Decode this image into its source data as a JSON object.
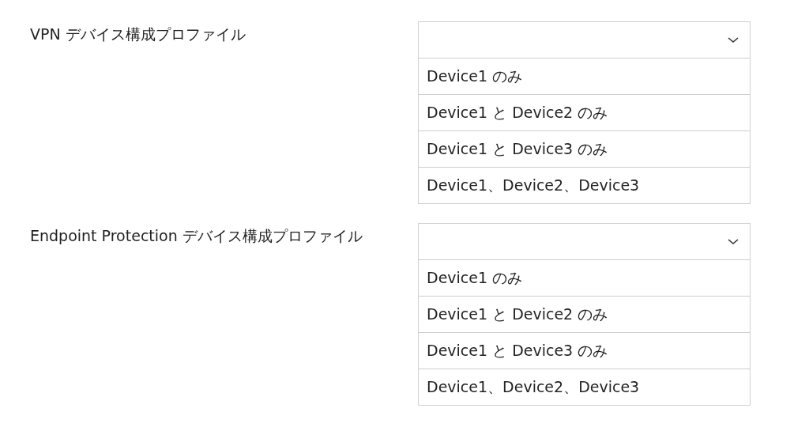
{
  "questions": [
    {
      "label": "VPN デバイス構成プロファイル",
      "options": [
        "Device1 のみ",
        "Device1 と Device2 のみ",
        "Device1 と Device3 のみ",
        "Device1、Device2、Device3"
      ]
    },
    {
      "label": "Endpoint Protection デバイス構成プロファイル",
      "options": [
        "Device1 のみ",
        "Device1 と Device2 のみ",
        "Device1 と Device3 のみ",
        "Device1、Device2、Device3"
      ]
    }
  ]
}
